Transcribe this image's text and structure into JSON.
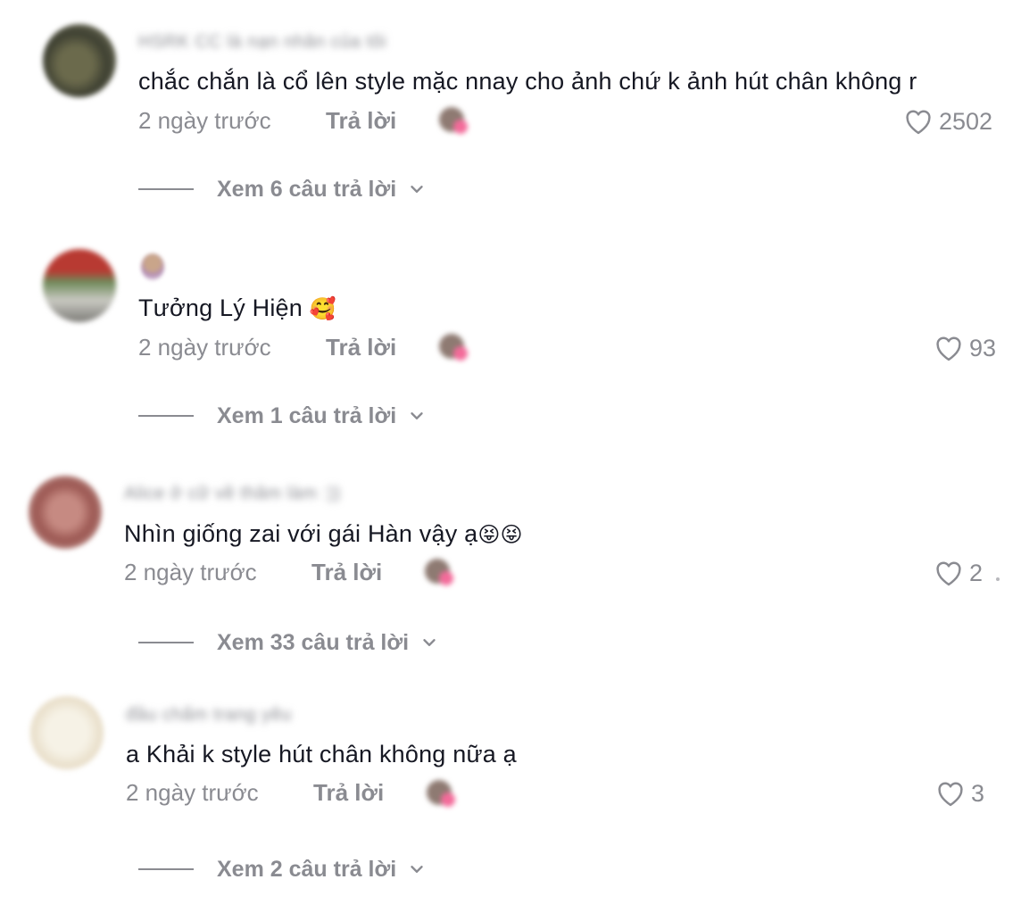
{
  "common": {
    "reply_label": "Trả lời",
    "time": "2 ngày trước"
  },
  "comments": [
    {
      "username": "HSRK CC là nạn nhân của tôi",
      "text": "chắc chắn là cổ lên style mặc nnay cho ảnh chứ k ảnh hút chân không r",
      "emoji": "",
      "time": "2 ngày trước",
      "reply_label": "Trả lời",
      "likes": "2502",
      "view_replies": "Xem 6 câu trả lời"
    },
    {
      "username": "",
      "text": "Tưởng Lý Hiện ",
      "emoji": "🥰",
      "time": "2 ngày trước",
      "reply_label": "Trả lời",
      "likes": "93",
      "view_replies": "Xem 1 câu trả lời"
    },
    {
      "username": "Alice ở cữ về thăm làm :))",
      "text": "Nhìn giống zai với gái Hàn vậy ạ",
      "emoji": "😝😝",
      "time": "2 ngày trước",
      "reply_label": "Trả lời",
      "likes": "2",
      "view_replies": "Xem 33 câu trả lời"
    },
    {
      "username": "đầu chấm trang yêu",
      "text": "a Khải k style hút chân không nữa ạ",
      "emoji": "",
      "time": "2 ngày trước",
      "reply_label": "Trả lời",
      "likes": "3",
      "view_replies": "Xem 2 câu trả lời"
    }
  ],
  "icons": {
    "like": "heart-outline-icon",
    "expand": "chevron-down-icon"
  },
  "colors": {
    "text_primary": "#161823",
    "text_secondary": "#8a8b91",
    "background": "#ffffff"
  }
}
